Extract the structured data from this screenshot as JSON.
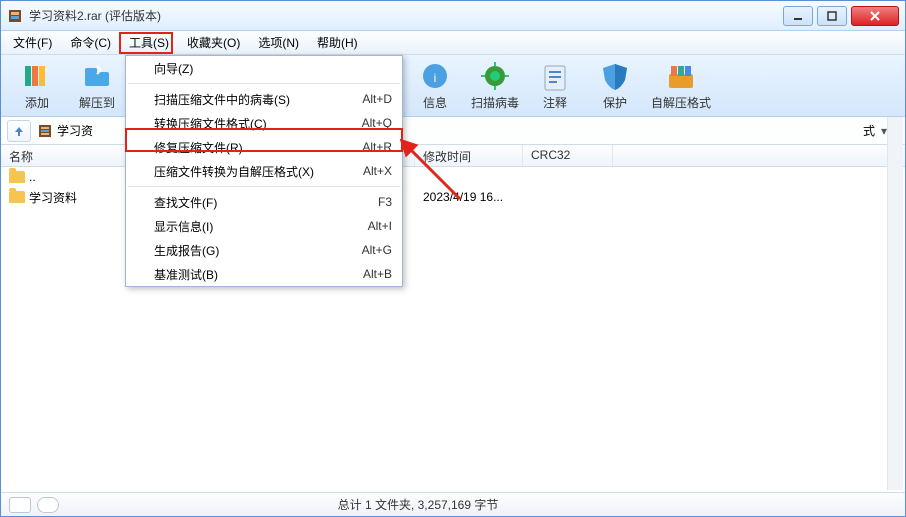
{
  "window": {
    "title": "学习资料2.rar (评估版本)"
  },
  "menus": {
    "file": "文件(F)",
    "commands": "命令(C)",
    "tools": "工具(S)",
    "favorites": "收藏夹(O)",
    "options": "选项(N)",
    "help": "帮助(H)"
  },
  "toolbar": {
    "add": "添加",
    "extract_to": "解压到",
    "info": "信息",
    "scan_virus": "扫描病毒",
    "comment": "注释",
    "protect": "保护",
    "sfx": "自解压格式"
  },
  "dropdown": {
    "wizard": "向导(Z)",
    "scan_virus": "扫描压缩文件中的病毒(S)",
    "scan_virus_sc": "Alt+D",
    "convert": "转换压缩文件格式(C)",
    "convert_sc": "Alt+Q",
    "repair": "修复压缩文件(R)",
    "repair_sc": "Alt+R",
    "convert_sfx": "压缩文件转换为自解压格式(X)",
    "convert_sfx_sc": "Alt+X",
    "find": "查找文件(F)",
    "find_sc": "F3",
    "show_info": "显示信息(I)",
    "show_info_sc": "Alt+I",
    "report": "生成报告(G)",
    "report_sc": "Alt+G",
    "benchmark": "基准测试(B)",
    "benchmark_sc": "Alt+B"
  },
  "path": {
    "archive_name": "学习资",
    "partial_suffix": "式"
  },
  "columns": {
    "name": "名称",
    "mtime": "修改时间",
    "crc": "CRC32"
  },
  "rows": {
    "up": "..",
    "folder1": "学习资料",
    "folder1_mtime": "2023/4/19 16..."
  },
  "status": {
    "summary": "总计 1 文件夹, 3,257,169 字节"
  }
}
